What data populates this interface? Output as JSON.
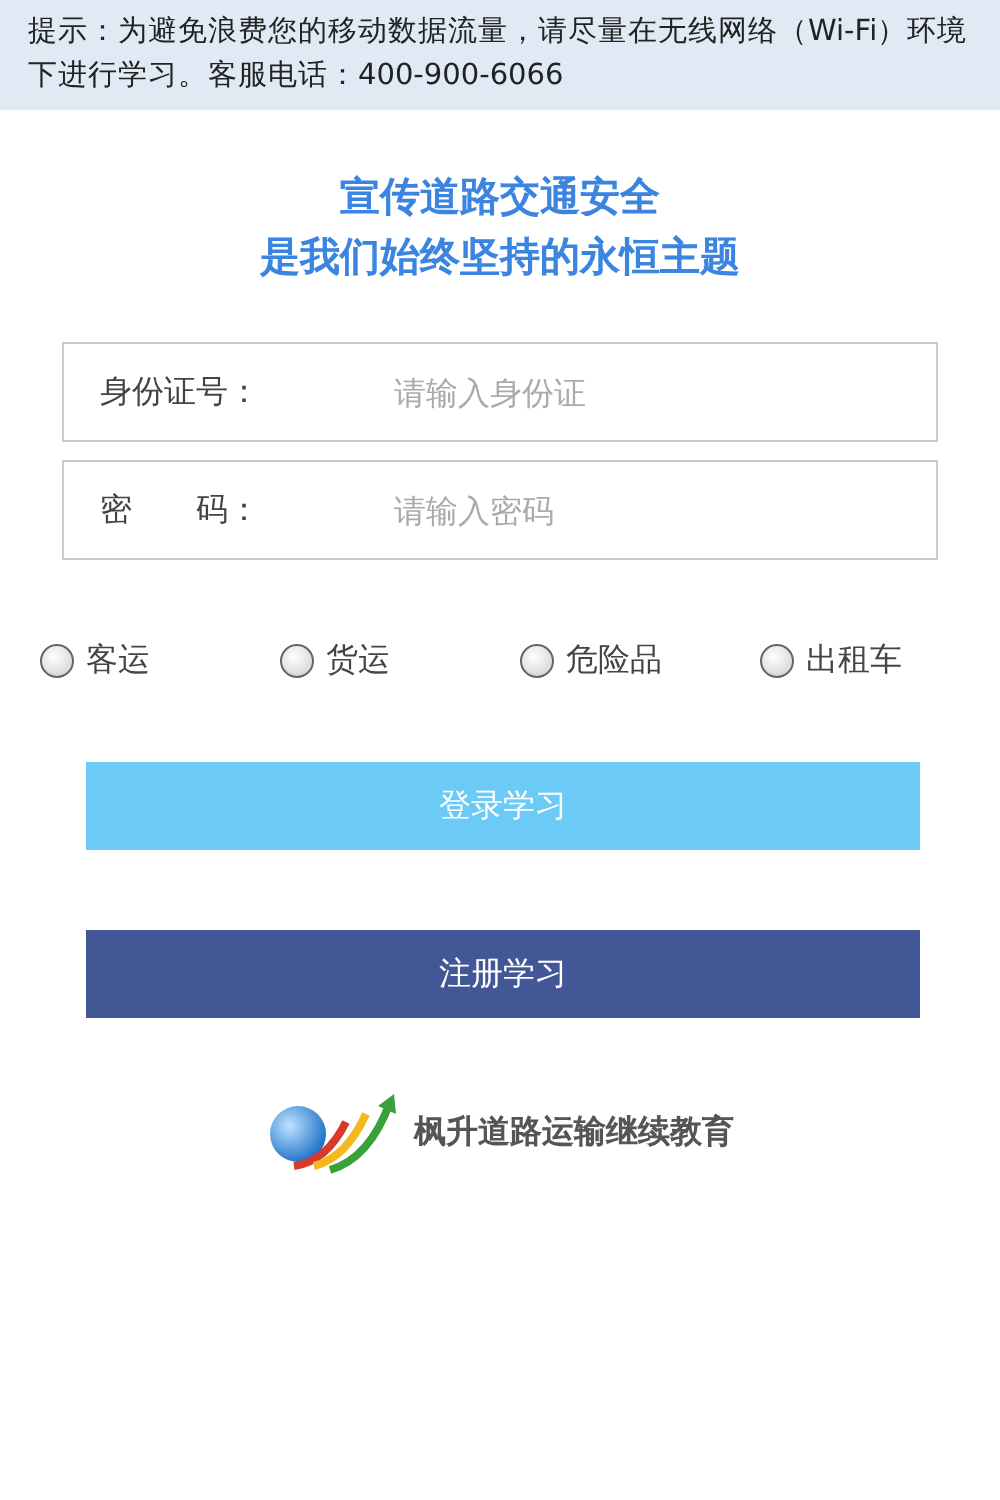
{
  "notice": "提示：为避免浪费您的移动数据流量，请尽量在无线网络（Wi-Fi）环境下进行学习。客服电话：400-900-6066",
  "slogan": [
    "宣传道路交通安全",
    "是我们始终坚持的永恒主题"
  ],
  "fields": [
    {
      "label": "身份证号：",
      "placeholder": "请输入身份证"
    },
    {
      "label": "密　　码：",
      "placeholder": "请输入密码"
    }
  ],
  "categories": [
    {
      "label": "客运",
      "selected": false
    },
    {
      "label": "货运",
      "selected": false
    },
    {
      "label": "危险品",
      "selected": false
    },
    {
      "label": "出租车",
      "selected": false
    }
  ],
  "buttons": [
    {
      "label": "登录学习",
      "kind": "login"
    },
    {
      "label": "注册学习",
      "kind": "register"
    }
  ],
  "brand": "枫升道路运输继续教育"
}
